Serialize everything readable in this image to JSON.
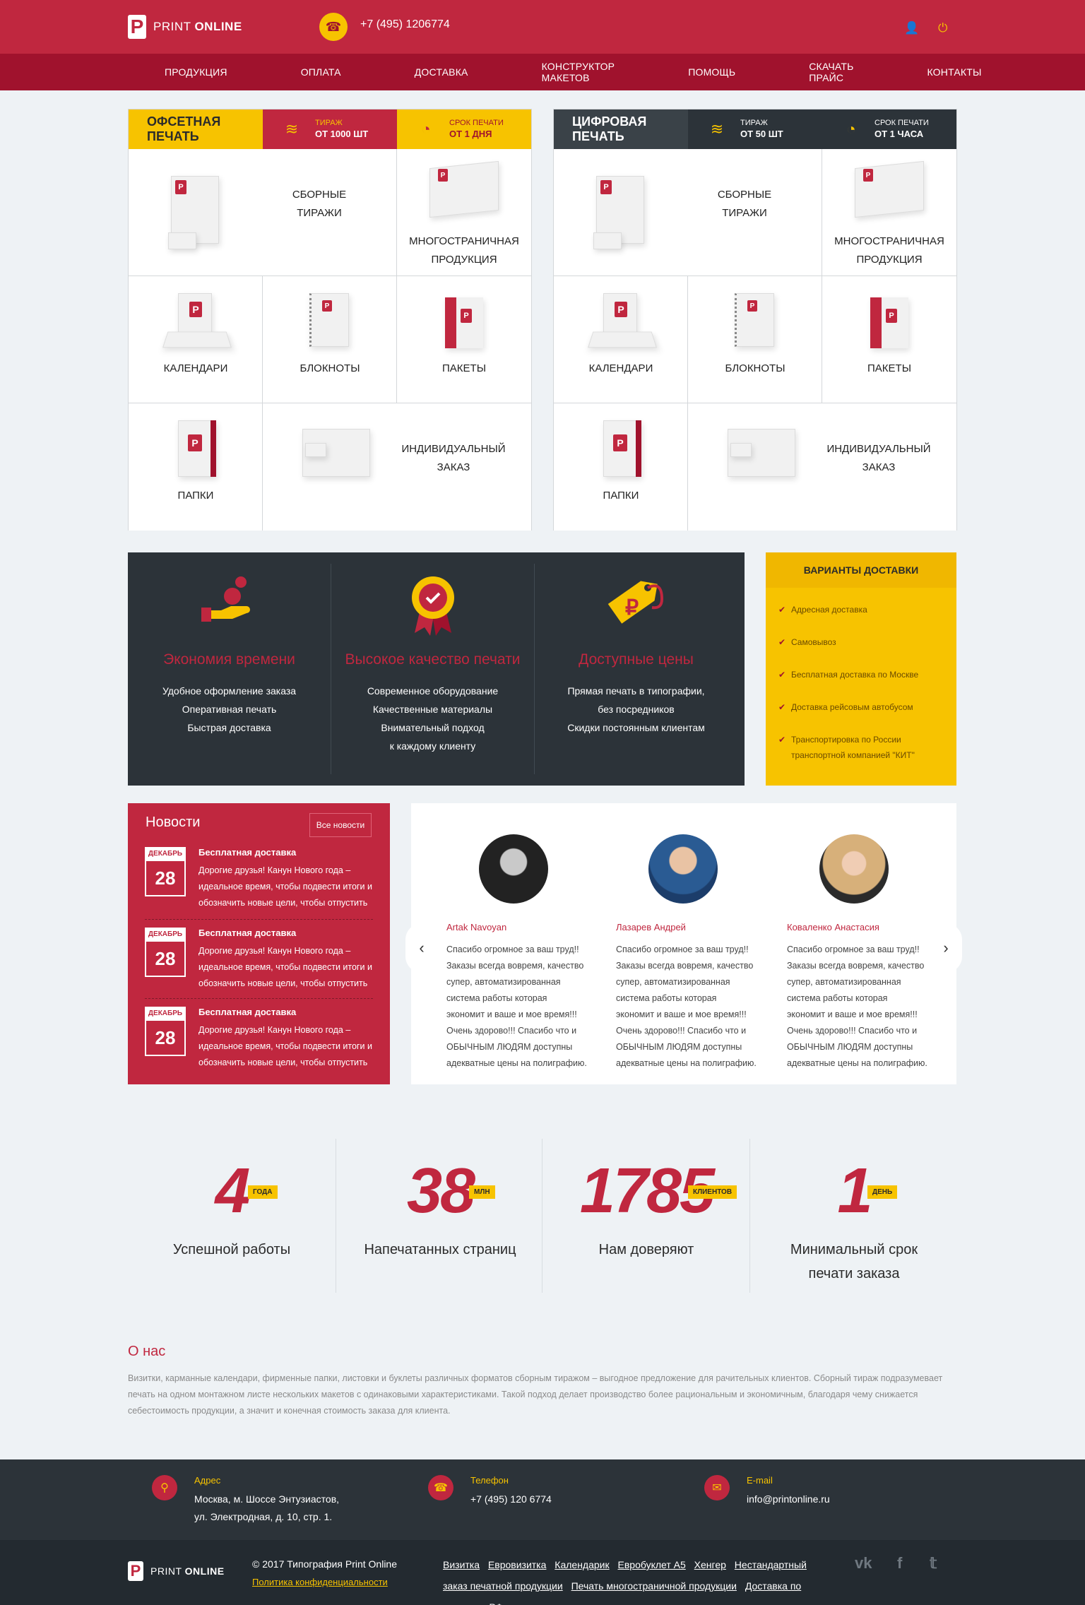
{
  "header": {
    "logo_text_light": "PRINT",
    "logo_text_bold": "ONLINE",
    "logo_letter": "P",
    "phone": "+7 (495) 1206774"
  },
  "nav": [
    "ПРОДУКЦИЯ",
    "ОПЛАТА",
    "ДОСТАВКА",
    "КОНСТРУКТОР МАКЕТОВ",
    "ПОМОЩЬ",
    "СКАЧАТЬ ПРАЙС",
    "КОНТАКТЫ"
  ],
  "offset": {
    "title": "ОФСЕТНАЯ ПЕЧАТЬ",
    "run_label": "ТИРАЖ",
    "run_value": "ОТ 1000 ШТ",
    "term_label": "СРОК ПЕЧАТИ",
    "term_value": "ОТ 1 ДНЯ",
    "products": {
      "sborn_1": "СБОРНЫЕ",
      "sborn_2": "ТИРАЖИ",
      "multi_1": "МНОГОСТРАНИЧНАЯ",
      "multi_2": "ПРОДУКЦИЯ",
      "calendars": "КАЛЕНДАРИ",
      "notebooks": "БЛОКНОТЫ",
      "bags": "ПАКЕТЫ",
      "folders": "ПАПКИ",
      "custom_1": "ИНДИВИДУАЛЬНЫЙ",
      "custom_2": "ЗАКАЗ"
    }
  },
  "digital": {
    "title": "ЦИФРОВАЯ ПЕЧАТЬ",
    "run_label": "ТИРАЖ",
    "run_value": "ОТ 50 ШТ",
    "term_label": "СРОК ПЕЧАТИ",
    "term_value": "ОТ 1 ЧАСА",
    "products": {
      "sborn_1": "СБОРНЫЕ",
      "sborn_2": "ТИРАЖИ",
      "multi_1": "МНОГОСТРАНИЧНАЯ",
      "multi_2": "ПРОДУКЦИЯ",
      "calendars": "КАЛЕНДАРИ",
      "notebooks": "БЛОКНОТЫ",
      "bags": "ПАКЕТЫ",
      "folders": "ПАПКИ",
      "custom_1": "ИНДИВИДУАЛЬНЫЙ",
      "custom_2": "ЗАКАЗ"
    }
  },
  "features": [
    {
      "title": "Экономия времени",
      "lines": [
        "Удобное оформление заказа",
        "Оперативная печать",
        "Быстрая доставка"
      ]
    },
    {
      "title": "Высокое качество печати",
      "lines": [
        "Современное оборудование",
        "Качественные материалы",
        "Внимательный подход",
        "к каждому клиенту"
      ]
    },
    {
      "title": "Доступные цены",
      "lines": [
        "Прямая печать в типографии,",
        "без посредников",
        "Скидки постоянным клиентам"
      ]
    }
  ],
  "delivery": {
    "title": "ВАРИАНТЫ ДОСТАВКИ",
    "items": [
      "Адресная доставка",
      "Самовывоз",
      "Бесплатная доставка по Москве",
      "Доставка рейсовым автобусом",
      "Транспортировка по России транспортной компанией \"КИТ\""
    ]
  },
  "news": {
    "title": "Новости",
    "all_button": "Все новости",
    "items": [
      {
        "month": "ДЕКАБРЬ",
        "day": "28",
        "head": "Бесплатная доставка",
        "text": "Дорогие друзья! Канун Нового года – идеальное время, чтобы подвести итоги и обозначить новые цели, чтобы отпустить"
      },
      {
        "month": "ДЕКАБРЬ",
        "day": "28",
        "head": "Бесплатная доставка",
        "text": "Дорогие друзья! Канун Нового года – идеальное время, чтобы подвести итоги и обозначить новые цели, чтобы отпустить"
      },
      {
        "month": "ДЕКАБРЬ",
        "day": "28",
        "head": "Бесплатная доставка",
        "text": "Дорогие друзья! Канун Нового года – идеальное время, чтобы подвести итоги и обозначить новые цели, чтобы отпустить"
      }
    ]
  },
  "reviews": [
    {
      "name": "Artak Navoyan",
      "text": "Спасибо огромное за ваш труд!! Заказы всегда вовремя, качество супер, автоматизированная система работы которая экономит и ваше и мое время!!! Очень здорово!!! Спасибо что и ОБЫЧНЫМ ЛЮДЯМ доступны адекватные цены на полиграфию."
    },
    {
      "name": "Лазарев Андрей",
      "text": "Спасибо огромное за ваш труд!! Заказы всегда вовремя, качество супер, автоматизированная система работы которая экономит и ваше и мое время!!! Очень здорово!!! Спасибо что и ОБЫЧНЫМ ЛЮДЯМ доступны адекватные цены на полиграфию."
    },
    {
      "name": "Коваленко Анастасия",
      "text": "Спасибо огромное за ваш труд!! Заказы всегда вовремя, качество супер, автоматизированная система работы которая экономит и ваше и мое время!!! Очень здорово!!! Спасибо что и ОБЫЧНЫМ ЛЮДЯМ доступны адекватные цены на полиграфию."
    }
  ],
  "stats": [
    {
      "num": "4",
      "badge": "ГОДА",
      "label1": "Успешной работы",
      "label2": ""
    },
    {
      "num": "38",
      "badge": "МЛН",
      "label1": "Напечатанных страниц",
      "label2": ""
    },
    {
      "num": "1785",
      "badge": "КЛИЕНТОВ",
      "label1": "Нам доверяют",
      "label2": ""
    },
    {
      "num": "1",
      "badge": "ДЕНЬ",
      "label1": "Минимальный срок",
      "label2": "печати заказа"
    }
  ],
  "about": {
    "title": "О нас",
    "text": "Визитки, карманные календари, фирменные папки, листовки и буклеты различных форматов сборным тиражом – выгодное предложение для рачительных клиентов. Сборный тираж подразумевает печать на одном монтажном листе нескольких макетов с одинаковыми характеристиками. Такой подход делает производство более рациональным и экономичным, благодаря чему снижается себестоимость продукции, а значит и конечная стоимость заказа для клиента."
  },
  "footer": {
    "address_label": "Адрес",
    "address_1": "Москва, м. Шоссе Энтузиастов,",
    "address_2": "ул. Электродная, д. 10, стр. 1.",
    "phone_label": "Телефон",
    "phone": "+7 (495) 120 6774",
    "email_label": "E-mail",
    "email": "info@printonline.ru",
    "copyright": "© 2017 Типография Print Online",
    "policy": "Политика конфиденциальности",
    "links": [
      "Визитка",
      "Евровизитка",
      "Календарик",
      "Евробуклет А5",
      "Хенгер",
      "Нестандартный заказ печатной продукции",
      "Печать многостраничной продукции",
      "Доставка по регионам РФ"
    ],
    "social": [
      "vk",
      "f",
      "twitter"
    ]
  },
  "colors": {
    "red": "#c0273f",
    "dark_red": "#a0122d",
    "yellow": "#f7c300",
    "dark": "#2c3339"
  }
}
